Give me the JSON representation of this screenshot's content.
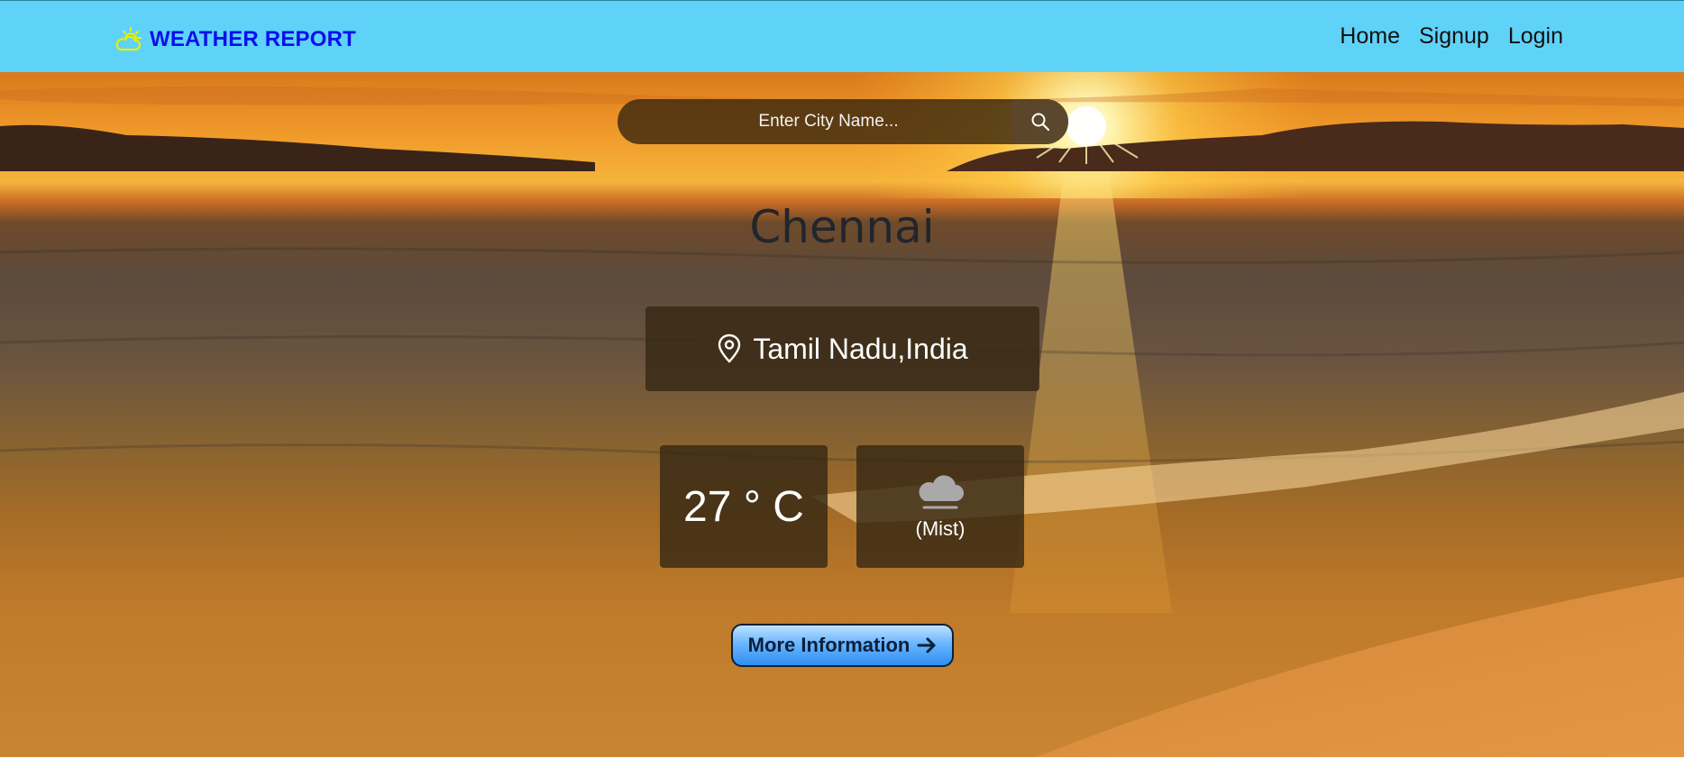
{
  "navbar": {
    "brand_text": "WEATHER REPORT",
    "brand_icon": "sun-cloud-icon",
    "links": [
      {
        "label": "Home"
      },
      {
        "label": "Signup"
      },
      {
        "label": "Login"
      }
    ],
    "background_color": "#5fd2f7",
    "brand_color": "#0a10ee"
  },
  "search": {
    "placeholder": "Enter City Name...",
    "value": "",
    "button_icon": "search-icon"
  },
  "weather": {
    "city": "Chennai",
    "location_icon": "map-pin-icon",
    "location": "Tamil Nadu,India",
    "temperature": "27 ° C",
    "condition_icon": "cloud-icon",
    "condition": "(Mist)"
  },
  "more_button": {
    "label": "More Information",
    "icon": "arrow-right-icon"
  }
}
